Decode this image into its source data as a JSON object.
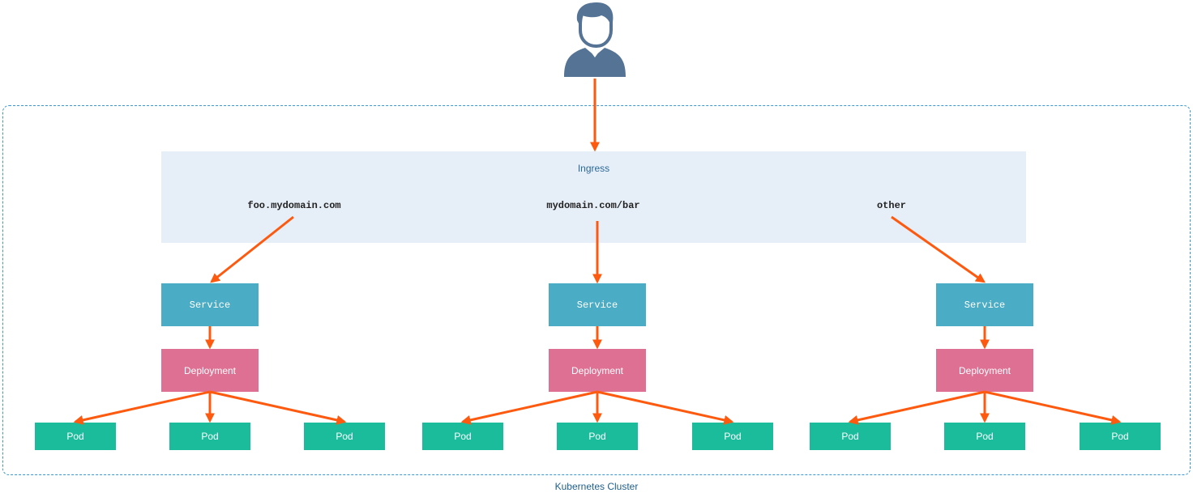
{
  "user": {
    "icon": "user-avatar-icon",
    "color": "#557394"
  },
  "cluster": {
    "label": "Kubernetes Cluster",
    "border_color": "#3a97cf"
  },
  "ingress": {
    "title": "Ingress",
    "rules": [
      "foo.mydomain.com",
      "mydomain.com/bar",
      "other"
    ]
  },
  "branches": [
    {
      "service": "Service",
      "deployment": "Deployment",
      "pods": [
        "Pod",
        "Pod",
        "Pod"
      ]
    },
    {
      "service": "Service",
      "deployment": "Deployment",
      "pods": [
        "Pod",
        "Pod",
        "Pod"
      ]
    },
    {
      "service": "Service",
      "deployment": "Deployment",
      "pods": [
        "Pod",
        "Pod",
        "Pod"
      ]
    }
  ],
  "colors": {
    "arrow": "#fd5a0f",
    "ingress_bg": "#e6eef8",
    "service": "#4aacc5",
    "deployment": "#dd7093",
    "pod": "#1bbc9b"
  }
}
